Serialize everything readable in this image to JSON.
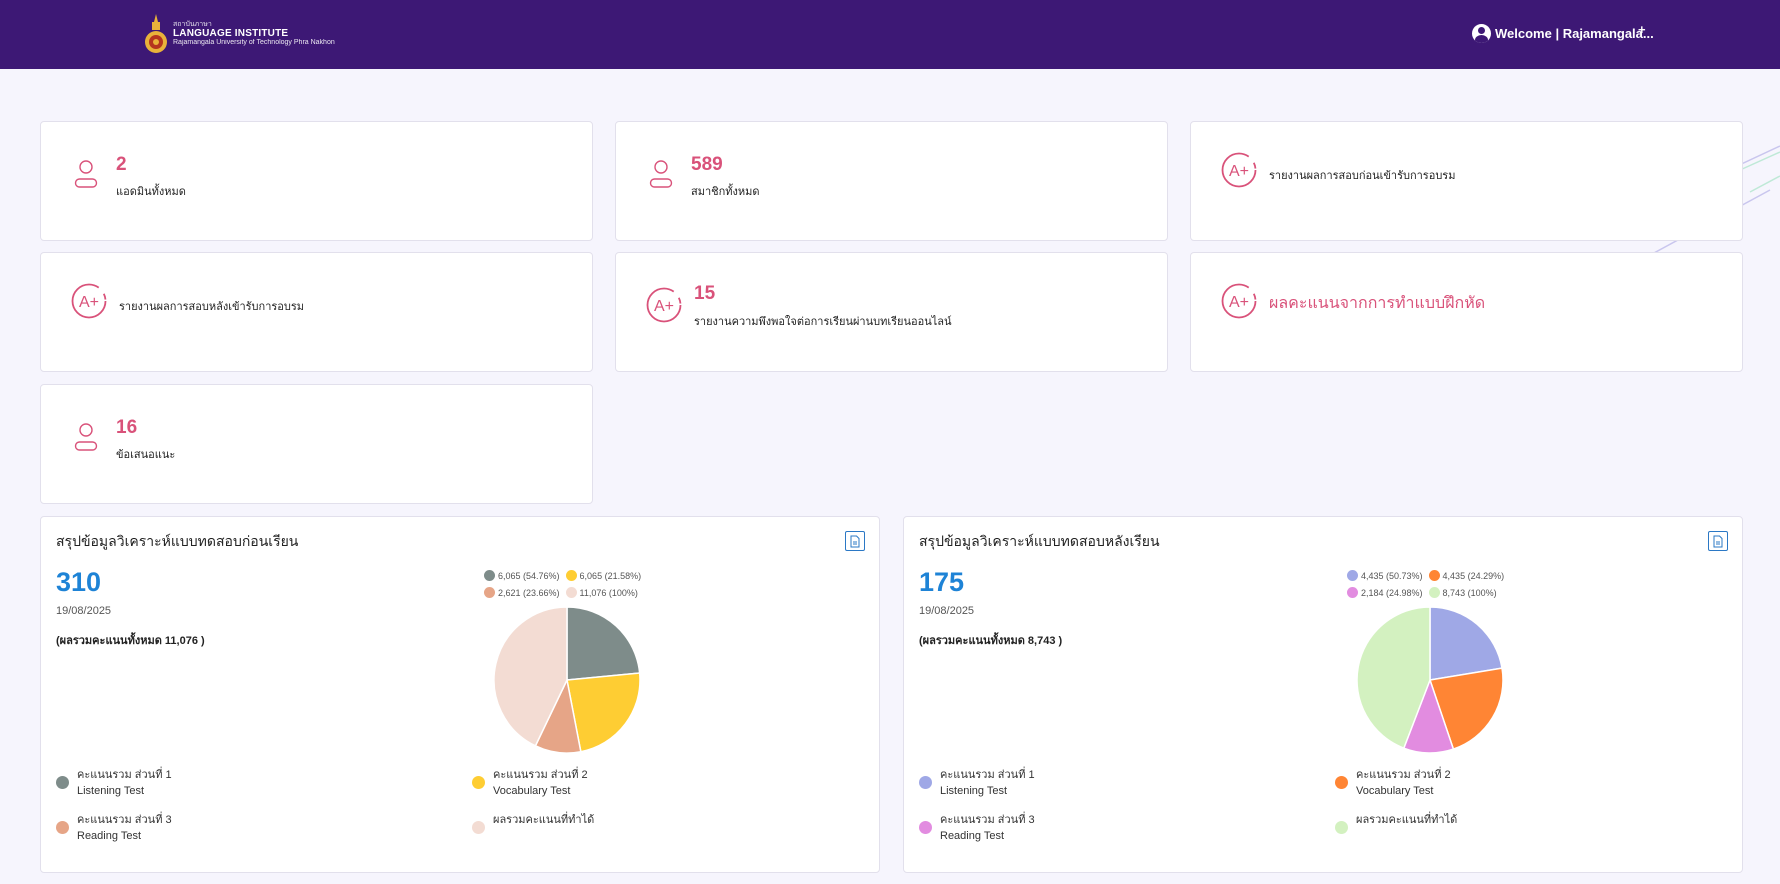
{
  "header": {
    "logo_small": "สถาบันภาษา",
    "logo_title": "LANGUAGE INSTITUTE",
    "logo_sub": "Rajamangala University of Technology Phra Nakhon",
    "welcome": "Welcome | Rajamangala...",
    "plus": "+"
  },
  "stats": [
    {
      "value": "2",
      "label": "แอดมินทั้งหมด",
      "icon": "user-icon"
    },
    {
      "value": "589",
      "label": "สมาชิกทั้งหมด",
      "icon": "user-icon"
    },
    {
      "value": "",
      "label": "รายงานผลการสอบก่อนเข้ารับการอบรม",
      "icon": "grade-a-plus-icon"
    },
    {
      "value": "",
      "label": "รายงานผลการสอบหลังเข้ารับการอบรม",
      "icon": "grade-a-plus-icon"
    },
    {
      "value": "15",
      "label": "รายงานความพึงพอใจต่อการเรียนผ่านบทเรียนออนไลน์",
      "icon": "grade-a-plus-icon"
    },
    {
      "value": "",
      "label": "ผลคะแนนจากการทำแบบฝึกหัด",
      "icon": "grade-a-plus-icon"
    },
    {
      "value": "16",
      "label": "ข้อเสนอแนะ",
      "icon": "user-icon"
    }
  ],
  "pretest": {
    "title": "สรุปข้อมูลวิเคราะห์แบบทดสอบก่อนเรียน",
    "count": "310",
    "date": "19/08/2025",
    "total": "(ผลรวมคะแนนทั้งหมด 11,076 )",
    "slice_labels": [
      "6,065 (54.76%)",
      "6,065 (21.58%)",
      "2,621 (23.66%)",
      "11,076 (100%)"
    ],
    "legend": [
      {
        "line1": "คะแนนรวม ส่วนที่ 1",
        "line2": "Listening Test"
      },
      {
        "line1": "คะแนนรวม ส่วนที่ 2",
        "line2": "Vocabulary Test"
      },
      {
        "line1": "คะแนนรวม ส่วนที่ 3",
        "line2": "Reading Test"
      },
      {
        "line1": "ผลรวมคะแนนที่ทำได้",
        "line2": ""
      }
    ],
    "colors": [
      "#7e8c8a",
      "#fecd33",
      "#e6a587",
      "#f3dcd3"
    ],
    "values": [
      6065,
      6065,
      2621,
      11076
    ]
  },
  "posttest": {
    "title": "สรุปข้อมูลวิเคราะห์แบบทดสอบหลังเรียน",
    "count": "175",
    "date": "19/08/2025",
    "total": "(ผลรวมคะแนนทั้งหมด 8,743 )",
    "slice_labels": [
      "4,435 (50.73%)",
      "4,435 (24.29%)",
      "2,184 (24.98%)",
      "8,743 (100%)"
    ],
    "legend": [
      {
        "line1": "คะแนนรวม ส่วนที่ 1",
        "line2": "Listening Test"
      },
      {
        "line1": "คะแนนรวม ส่วนที่ 2",
        "line2": "Vocabulary Test"
      },
      {
        "line1": "คะแนนรวม ส่วนที่ 3",
        "line2": "Reading Test"
      },
      {
        "line1": "ผลรวมคะแนนที่ทำได้",
        "line2": ""
      }
    ],
    "colors": [
      "#9fa8e6",
      "#ff8534",
      "#e28ce0",
      "#d3f1c0"
    ],
    "values": [
      4435,
      4435,
      2184,
      8743
    ]
  }
}
